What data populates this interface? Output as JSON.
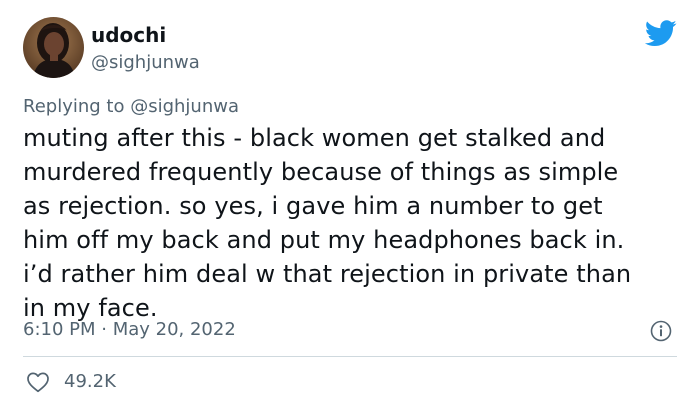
{
  "author": {
    "display_name": "udochi",
    "handle": "@sighjunwa",
    "avatar_icon": "profile-photo"
  },
  "brand": {
    "logo_icon": "twitter-bird-icon",
    "accent_color": "#1d9bf0"
  },
  "reply": {
    "prefix": "Replying to",
    "mention": "@sighjunwa"
  },
  "tweet": {
    "lines": [
      "muting after this - black women get stalked and",
      "murdered frequently because of things as simple",
      "as rejection. so yes, i gave him a number to get",
      "him off my back and put my headphones back in.",
      "i’d rather him deal w that rejection in private than",
      "in my face."
    ],
    "timestamp": "6:10 PM · May 20, 2022"
  },
  "actions": {
    "like_count": "49.2K",
    "like_icon": "heart-icon",
    "info_icon": "info-icon"
  }
}
